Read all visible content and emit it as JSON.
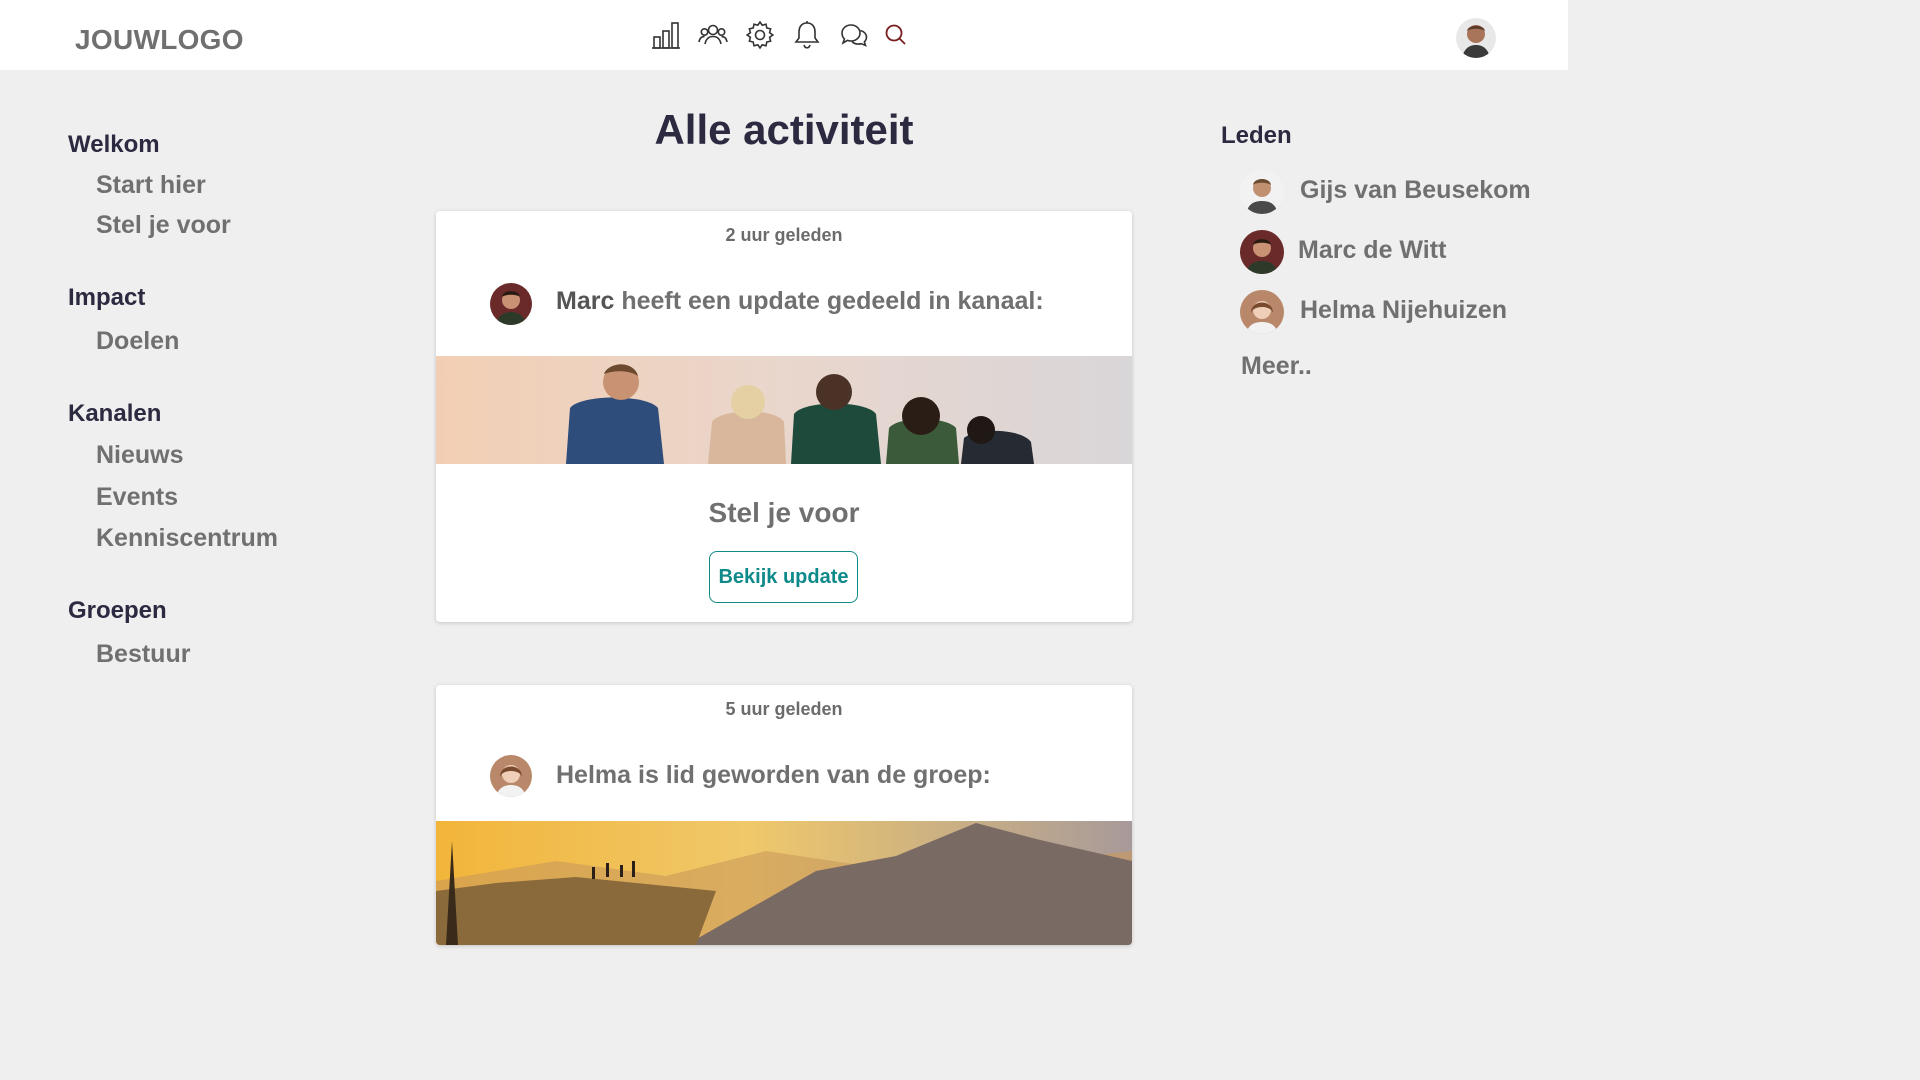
{
  "header": {
    "logo": "JOUWLOGO",
    "icons": [
      "bar-chart-icon",
      "users-icon",
      "gear-icon",
      "bell-icon",
      "chat-icon",
      "search-icon"
    ]
  },
  "sidebar": {
    "sections": [
      {
        "title": "Welkom",
        "items": [
          "Start hier",
          "Stel je voor"
        ]
      },
      {
        "title": "Impact",
        "items": [
          "Doelen"
        ]
      },
      {
        "title": "Kanalen",
        "items": [
          "Nieuws",
          "Events",
          "Kenniscentrum"
        ]
      },
      {
        "title": "Groepen",
        "items": [
          "Bestuur"
        ]
      }
    ]
  },
  "main": {
    "title": "Alle activiteit",
    "posts": [
      {
        "time": "2 uur geleden",
        "author": "Marc",
        "text": " heeft een update gedeeld in kanaal:",
        "subtitle": "Stel je voor",
        "button": "Bekijk update"
      },
      {
        "time": "5 uur geleden",
        "author": "Helma",
        "text": " is lid geworden van de groep:"
      }
    ]
  },
  "members": {
    "title": "Leden",
    "list": [
      "Gijs van Beusekom",
      "Marc de Witt",
      "Helma Nijehuizen"
    ],
    "more": "Meer.."
  },
  "colors": {
    "background": "#efefef",
    "heading": "#2c2a40",
    "text": "#707070",
    "accent": "#0f8a8a"
  }
}
